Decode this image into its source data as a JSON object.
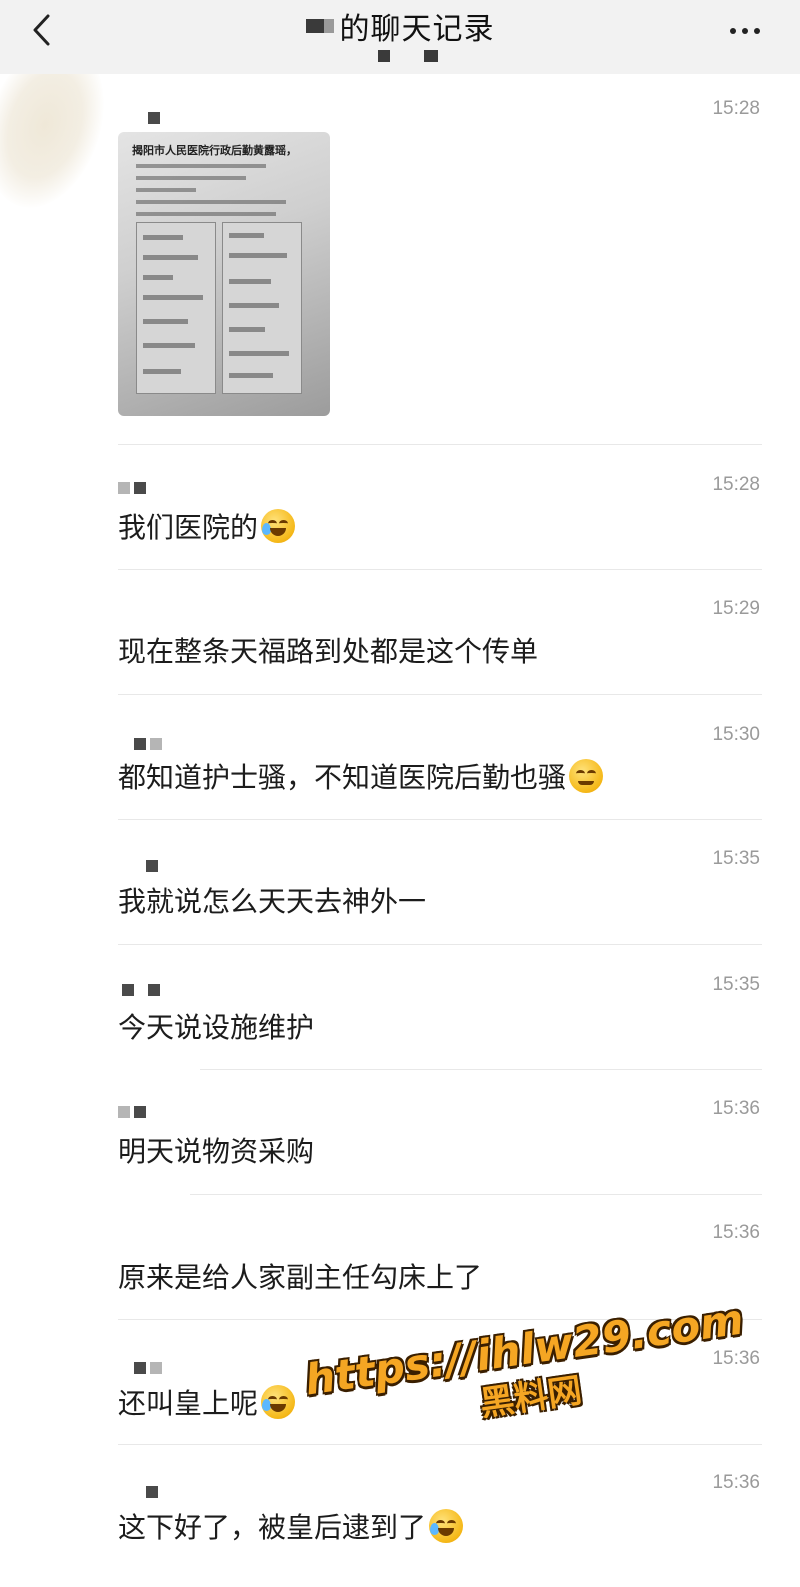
{
  "nav": {
    "title": "的聊天记录",
    "back_icon": "chevron-left-icon",
    "more_icon": "more-dots-icon"
  },
  "messages": [
    {
      "time": "15:28",
      "type": "image",
      "image": {
        "title": "揭阳市人民医院行政后勤黄露瑶，"
      }
    },
    {
      "time": "15:28",
      "text": "我们医院的",
      "emoji": "laugh-cry"
    },
    {
      "time": "15:29",
      "text": "现在整条天福路到处都是这个传单"
    },
    {
      "time": "15:30",
      "text": "都知道护士骚，不知道医院后勤也骚",
      "emoji": "smirk"
    },
    {
      "time": "15:35",
      "text": "我就说怎么天天去神外一"
    },
    {
      "time": "15:35",
      "text": "今天说设施维护"
    },
    {
      "time": "15:36",
      "text": "明天说物资采购"
    },
    {
      "time": "15:36",
      "text": "原来是给人家副主任勾床上了"
    },
    {
      "time": "15:36",
      "text": "还叫皇上呢",
      "emoji": "laugh-cry"
    },
    {
      "time": "15:36",
      "text": "这下好了，被皇后逮到了",
      "emoji": "laugh-cry"
    }
  ],
  "watermark": {
    "url": "https://ihlw29.com",
    "name": "黑料网"
  }
}
